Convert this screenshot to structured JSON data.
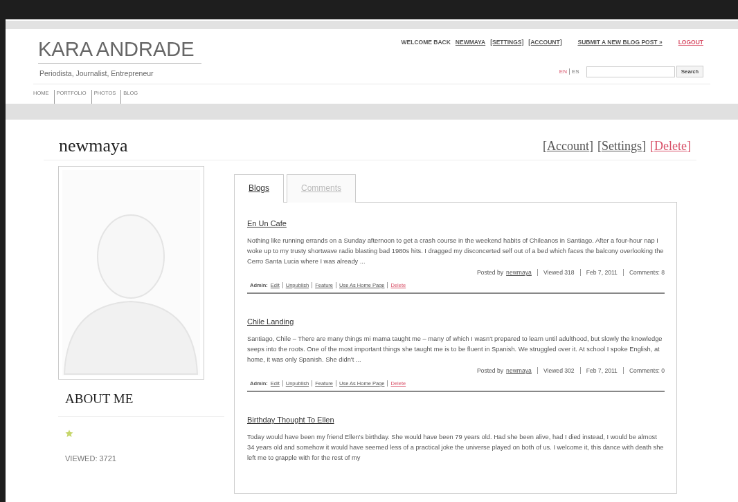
{
  "site": {
    "title": "KARA ANDRADE",
    "tagline": "Periodista, Journalist, Entrepreneur",
    "nav": [
      "HOME",
      "PORTFOLIO",
      "PHOTOS",
      "BLOG"
    ],
    "welcome": "WELCOME BACK",
    "user_links": [
      {
        "label": "NEWMAYA",
        "kind": "link"
      },
      {
        "label": "[SETTINGS]",
        "kind": "link"
      },
      {
        "label": "[ACCOUNT]",
        "kind": "link"
      },
      {
        "label": "SUBMIT A NEW BLOG POST »",
        "kind": "link"
      },
      {
        "label": "LOGOUT",
        "kind": "danger"
      }
    ],
    "languages": [
      {
        "label": "EN",
        "selected": true
      },
      {
        "label": "ES",
        "selected": false
      }
    ],
    "search_button": "Search"
  },
  "profile": {
    "username": "newmaya",
    "actions": [
      {
        "label": "[Account]",
        "kind": "link"
      },
      {
        "label": "[Settings]",
        "kind": "link"
      },
      {
        "label": "[Delete]",
        "kind": "danger"
      }
    ],
    "about_heading": "ABOUT ME",
    "viewed": "VIEWED: 3721"
  },
  "tabs": [
    {
      "label": "Blogs",
      "selected": true
    },
    {
      "label": "Comments",
      "selected": false
    }
  ],
  "posts": [
    {
      "title": "En Un Cafe",
      "excerpt": "Nothing like running errands on a Sunday afternoon to get a crash course in the weekend habits of Chileanos in Santiago. After a four-hour nap I woke up to my trusty shortwave radio blasting bad 1980s hits. I dragged my disconcerted self out of a bed which faces the balcony overlooking the Cerro Santa Lucia where I was already ...",
      "posted_by": "Posted by",
      "author": "newmaya",
      "viewed": "Viewed 318",
      "date": "Feb 7, 2011",
      "comments": "Comments: 8",
      "admin_label": "Admin:",
      "admin_links": [
        {
          "label": "Edit",
          "kind": "link"
        },
        {
          "label": "Unpublish",
          "kind": "link"
        },
        {
          "label": "Feature",
          "kind": "link"
        },
        {
          "label": "Use As Home Page",
          "kind": "link"
        },
        {
          "label": "Delete",
          "kind": "danger"
        }
      ]
    },
    {
      "title": "Chile Landing",
      "excerpt": "Santiago, Chile – There are many things mi mama taught me – many of which I wasn't prepared to learn until adulthood, but slowly the knowledge seeps into the roots.  One of the most important things she taught me is to be fluent in Spanish. We struggled over it. At school I spoke English, at home, it was only Spanish. She didn't ...",
      "posted_by": "Posted by",
      "author": "newmaya",
      "viewed": "Viewed 302",
      "date": "Feb 7, 2011",
      "comments": "Comments: 0",
      "admin_label": "Admin:",
      "admin_links": [
        {
          "label": "Edit",
          "kind": "link"
        },
        {
          "label": "Unpublish",
          "kind": "link"
        },
        {
          "label": "Feature",
          "kind": "link"
        },
        {
          "label": "Use As Home Page",
          "kind": "link"
        },
        {
          "label": "Delete",
          "kind": "danger"
        }
      ]
    },
    {
      "title": "Birthday Thought To Ellen",
      "excerpt": "Today would have been my friend Ellen's birthday. She would have been 79 years old. Had she been alive, had I died instead, I would be almost 34 years old and somehow it would have seemed less of a practical joke the universe played on both of us. I welcome it, this dance with death she left me to grapple with for the rest of my"
    }
  ]
}
